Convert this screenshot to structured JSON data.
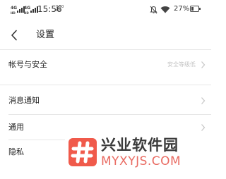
{
  "status_bar": {
    "signal1_label": "4G",
    "signal1_sub": "HD",
    "signal2_label": "4G",
    "signal2_sub": "HD",
    "time": "15:56",
    "net_speed": "0.50 K/s",
    "battery_text": "27%",
    "battery_level": 0.27,
    "icons": [
      "signal-icon",
      "mute-icon",
      "wifi-icon",
      "battery-icon"
    ]
  },
  "header": {
    "title": "设置",
    "back_icon": "chevron-left-icon"
  },
  "settings": {
    "items": [
      {
        "label": "帐号与安全",
        "value": "安全等级低"
      },
      {
        "label": "消息通知",
        "value": ""
      },
      {
        "label": "通用",
        "value": ""
      },
      {
        "label": "隐私",
        "value": ""
      }
    ]
  },
  "watermark": {
    "logo_icon": "hash-logo-icon",
    "title": "兴业软件园",
    "url": "MYXYJS.COM",
    "logo_color": "#f05a4b",
    "url_color": "#e96b62"
  },
  "colors": {
    "background": "#ffffff",
    "text": "#222222",
    "muted": "#c4c4c4",
    "divider": "#e6e6e6"
  }
}
